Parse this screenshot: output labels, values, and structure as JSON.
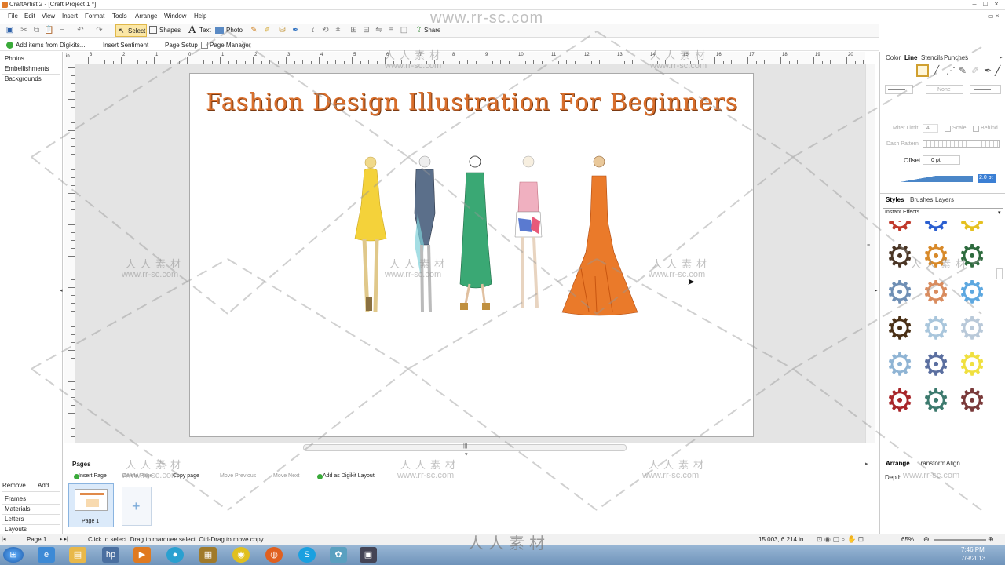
{
  "window": {
    "title": "CraftArtist 2 - [Craft Project 1 *]"
  },
  "menu": [
    "File",
    "Edit",
    "View",
    "Insert",
    "Format",
    "Tools",
    "Arrange",
    "Window",
    "Help"
  ],
  "toolbar": {
    "select_label": "Select",
    "shapes_label": "Shapes",
    "text_label": "Text",
    "photo_label": "Photo",
    "share_label": "Share"
  },
  "toolbar2": {
    "add_items_label": "Add items from Digikits...",
    "insert_sentiment_label": "Insert Sentiment",
    "page_setup_label": "Page Setup",
    "page_manager_label": "Page Manager"
  },
  "left_panel": {
    "top_items": [
      "Photos",
      "Embellishments",
      "Backgrounds"
    ],
    "remove_label": "Remove",
    "add_label": "Add...",
    "bottom_items": [
      "Frames",
      "Materials",
      "Letters",
      "Layouts"
    ]
  },
  "ruler": {
    "numbers": [
      "3",
      "2",
      "1",
      "0",
      "1",
      "2",
      "3",
      "4",
      "5",
      "6",
      "7",
      "8",
      "9",
      "10",
      "11",
      "12",
      "13",
      "14",
      "15",
      "16",
      "17",
      "18",
      "19",
      "20"
    ]
  },
  "canvas": {
    "title": "Fashion Design Illustration For Beginners"
  },
  "pages_panel": {
    "title": "Pages",
    "insert_page": "Insert Page",
    "delete_page": "Delete Page",
    "copy_page": "Copy page",
    "move_previous": "Move Previous",
    "move_next": "Move Next",
    "add_digikit_layout": "Add as Digikit Layout",
    "page_label": "Page 1"
  },
  "right_panel": {
    "tabs_top": [
      "Color",
      "Line",
      "Stencils",
      "Punches"
    ],
    "none_label": "None",
    "miter_label": "Miter Limit",
    "miter_value": "4",
    "scale_label": "Scale",
    "behind_label": "Behind",
    "dash_label": "Dash Pattern",
    "offset_label": "Offset",
    "offset_value": "0 pt",
    "line_width_value": "2.0 pt",
    "tabs_mid": [
      "Styles",
      "Brushes",
      "Layers"
    ],
    "effects_dropdown": "Instant Effects",
    "gear_colors": [
      "#c0392b",
      "#2b5fd0",
      "#e5c020",
      "#4a3524",
      "#d88a2a",
      "#2e6b3e",
      "#6f8fb5",
      "#d98c5f",
      "#5ea8e0",
      "#4a3016",
      "#a9c6dc",
      "#b9c9d9",
      "#8fb4d4",
      "#5b6fa0",
      "#f0e040",
      "#a8262a",
      "#3d7a6e",
      "#7a3a3a"
    ],
    "tabs_bottom": [
      "Arrange",
      "Transform",
      "Align"
    ],
    "depth_label": "Depth"
  },
  "status": {
    "page_label": "Page 1",
    "hint": "Click to select. Drag to marquee select. Ctrl-Drag to move copy.",
    "coords": "15.003, 6.214 in",
    "zoom": "65%"
  },
  "taskbar": {
    "time": "7:46 PM",
    "date": "7/9/2013"
  },
  "watermark": {
    "url": "www.rr-sc.com",
    "cn": "人人素材"
  }
}
